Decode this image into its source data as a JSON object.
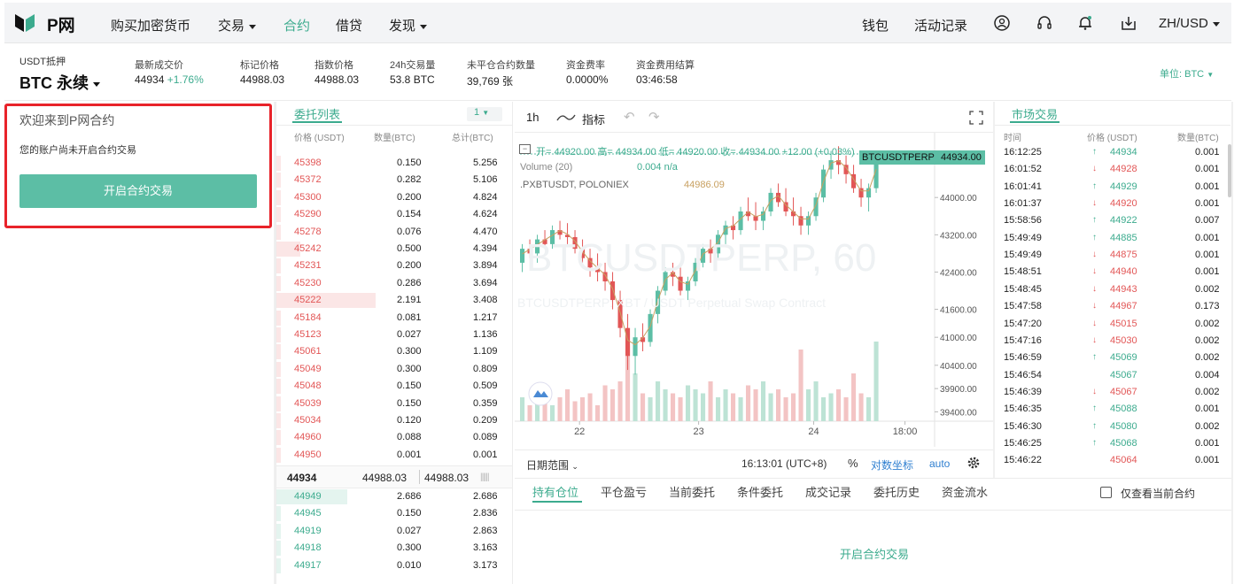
{
  "nav": {
    "logo": "P网",
    "items": [
      "购买加密货币",
      "交易",
      "合约",
      "借贷",
      "发现"
    ],
    "right": [
      "钱包",
      "活动记录"
    ],
    "lang": "ZH/USD"
  },
  "ticker": {
    "collateral": "USDT抵押",
    "pair": "BTC 永续",
    "last_label": "最新成交价",
    "last_value": "44934",
    "last_change": "+1.76%",
    "mark_label": "标记价格",
    "mark_value": "44988.03",
    "index_label": "指数价格",
    "index_value": "44988.03",
    "vol_label": "24h交易量",
    "vol_value": "53.8 BTC",
    "oi_label": "未平仓合约数量",
    "oi_value": "39,769 张",
    "funding_label": "资金费率",
    "funding_value": "0.0000%",
    "settle_label": "资金费用结算",
    "settle_value": "03:46:58",
    "unit": "单位: BTC"
  },
  "welcome": {
    "title": "欢迎来到P网合约",
    "desc": "您的账户尚未开启合约交易",
    "button": "开启合约交易"
  },
  "orderbook": {
    "title": "委托列表",
    "depth": "1",
    "headers": [
      "价格 (USDT)",
      "数量(BTC)",
      "总计(BTC)"
    ],
    "asks": [
      {
        "price": "45398",
        "qty": "0.150",
        "total": "5.256",
        "depth": 0.02
      },
      {
        "price": "45372",
        "qty": "0.282",
        "total": "5.106",
        "depth": 0.02
      },
      {
        "price": "45300",
        "qty": "0.200",
        "total": "4.824",
        "depth": 0.02
      },
      {
        "price": "45290",
        "qty": "0.154",
        "total": "4.624",
        "depth": 0.02
      },
      {
        "price": "45278",
        "qty": "0.076",
        "total": "4.470",
        "depth": 0.02
      },
      {
        "price": "45242",
        "qty": "0.500",
        "total": "4.394",
        "depth": 0.1
      },
      {
        "price": "45231",
        "qty": "0.200",
        "total": "3.894",
        "depth": 0.02
      },
      {
        "price": "45230",
        "qty": "0.286",
        "total": "3.694",
        "depth": 0.02
      },
      {
        "price": "45222",
        "qty": "2.191",
        "total": "3.408",
        "depth": 0.42
      },
      {
        "price": "45184",
        "qty": "0.081",
        "total": "1.217",
        "depth": 0.02
      },
      {
        "price": "45123",
        "qty": "0.027",
        "total": "1.136",
        "depth": 0.02
      },
      {
        "price": "45061",
        "qty": "0.300",
        "total": "1.109",
        "depth": 0.02
      },
      {
        "price": "45049",
        "qty": "0.300",
        "total": "0.809",
        "depth": 0.02
      },
      {
        "price": "45048",
        "qty": "0.150",
        "total": "0.509",
        "depth": 0.02
      },
      {
        "price": "45039",
        "qty": "0.150",
        "total": "0.359",
        "depth": 0.02
      },
      {
        "price": "45034",
        "qty": "0.120",
        "total": "0.209",
        "depth": 0.02
      },
      {
        "price": "44960",
        "qty": "0.088",
        "total": "0.089",
        "depth": 0.02
      },
      {
        "price": "44950",
        "qty": "0.001",
        "total": "0.001",
        "depth": 0.02
      }
    ],
    "mid_last": "44934",
    "mid_mark": "44988.03",
    "mid_index": "44988.03",
    "bids": [
      {
        "price": "44949",
        "qty": "2.686",
        "total": "2.686",
        "depth": 0.3
      },
      {
        "price": "44945",
        "qty": "0.150",
        "total": "2.836",
        "depth": 0.02
      },
      {
        "price": "44919",
        "qty": "0.027",
        "total": "2.863",
        "depth": 0.02
      },
      {
        "price": "44918",
        "qty": "0.300",
        "total": "3.163",
        "depth": 0.02
      },
      {
        "price": "44917",
        "qty": "0.010",
        "total": "3.173",
        "depth": 0.02
      }
    ]
  },
  "chart_toolbar": {
    "interval": "1h",
    "indicators": "指标"
  },
  "chart_legend": {
    "ohlc": "开= 44920.00  高= 44934.00  低= 44920.00  收= 44934.00  +12.00 (+0.03%)",
    "volume_label": "Volume (20)",
    "volume_value": "0.004  n/a",
    "compare_label": ".PXBTUSDT, POLONIEX",
    "compare_value": "44986.09",
    "watermark": "BTCUSDTPERP, 60",
    "watermark_sub": "BTCUSDTPERP: XBT / USDT Perpetual Swap Contract",
    "price_tag_symbol": "BTCUSDTPERP",
    "price_tag_value": "44934.00"
  },
  "chart_data": {
    "type": "candlestick",
    "yticks": [
      "44000.00",
      "43200.00",
      "42400.00",
      "41600.00",
      "41000.00",
      "40400.00",
      "39900.00",
      "39400.00"
    ],
    "xticks": [
      "22",
      "23",
      "24",
      "18:00"
    ],
    "yrange": [
      39200,
      45200
    ],
    "last_price": 44934,
    "candles": [
      [
        42600,
        43000,
        42400,
        42900
      ],
      [
        42900,
        43100,
        42700,
        42800
      ],
      [
        42800,
        43200,
        42600,
        43100
      ],
      [
        43100,
        43300,
        42900,
        43000
      ],
      [
        43000,
        43400,
        42900,
        43300
      ],
      [
        43300,
        43500,
        43100,
        43200
      ],
      [
        43200,
        43450,
        43000,
        43150
      ],
      [
        43150,
        43300,
        42800,
        42900
      ],
      [
        42900,
        43100,
        42600,
        42700
      ],
      [
        42700,
        42900,
        42300,
        42500
      ],
      [
        42500,
        42800,
        42200,
        42400
      ],
      [
        42400,
        42600,
        42000,
        42200
      ],
      [
        42200,
        42400,
        41600,
        41800
      ],
      [
        41800,
        42000,
        41000,
        41200
      ],
      [
        41200,
        41500,
        40300,
        40600
      ],
      [
        40600,
        41200,
        40200,
        41000
      ],
      [
        41000,
        41300,
        40700,
        40900
      ],
      [
        40900,
        41600,
        40800,
        41500
      ],
      [
        41500,
        42100,
        41300,
        42000
      ],
      [
        42000,
        42500,
        41900,
        42400
      ],
      [
        42400,
        42600,
        42100,
        42300
      ],
      [
        42300,
        42500,
        41900,
        42000
      ],
      [
        42000,
        42300,
        41800,
        42200
      ],
      [
        42200,
        42700,
        42100,
        42600
      ],
      [
        42600,
        43000,
        42500,
        42900
      ],
      [
        42900,
        43100,
        42600,
        42800
      ],
      [
        42800,
        43300,
        42700,
        43200
      ],
      [
        43200,
        43500,
        43000,
        43400
      ],
      [
        43400,
        43600,
        43100,
        43300
      ],
      [
        43300,
        43800,
        43200,
        43700
      ],
      [
        43700,
        44000,
        43500,
        43600
      ],
      [
        43600,
        43900,
        43300,
        43500
      ],
      [
        43500,
        43800,
        43300,
        43700
      ],
      [
        43700,
        44200,
        43600,
        44100
      ],
      [
        44100,
        44300,
        43800,
        43900
      ],
      [
        43900,
        44200,
        43600,
        43700
      ],
      [
        43700,
        44000,
        43400,
        43600
      ],
      [
        43600,
        43800,
        43200,
        43400
      ],
      [
        43400,
        43700,
        43200,
        43600
      ],
      [
        43600,
        44100,
        43500,
        44000
      ],
      [
        44000,
        44700,
        43900,
        44600
      ],
      [
        44600,
        45000,
        44400,
        44800
      ],
      [
        44800,
        45100,
        44500,
        44700
      ],
      [
        44700,
        44900,
        44300,
        44500
      ],
      [
        44500,
        44700,
        44100,
        44200
      ],
      [
        44200,
        44400,
        43800,
        44000
      ],
      [
        44000,
        44300,
        43700,
        44200
      ],
      [
        44200,
        44934,
        44100,
        44934
      ]
    ],
    "volumes": [
      0.3,
      0.2,
      0.25,
      0.35,
      0.2,
      0.3,
      0.4,
      0.25,
      0.3,
      0.35,
      0.2,
      0.45,
      0.4,
      0.5,
      0.95,
      0.6,
      0.35,
      0.3,
      0.5,
      0.4,
      0.35,
      0.3,
      0.45,
      0.4,
      0.35,
      0.5,
      0.3,
      0.4,
      0.35,
      0.3,
      0.45,
      0.4,
      0.5,
      0.35,
      0.4,
      0.3,
      0.35,
      0.9,
      0.4,
      0.5,
      0.3,
      0.35,
      0.4,
      0.3,
      0.6,
      0.35,
      0.3,
      1.0
    ]
  },
  "chart_footer": {
    "range": "日期范围",
    "time": "16:13:01 (UTC+8)",
    "percent": "%",
    "log": "对数坐标",
    "auto": "auto"
  },
  "trades": {
    "title": "市场交易",
    "headers": [
      "时间",
      "价格 (USDT)",
      "数量(BTC)"
    ],
    "rows": [
      {
        "time": "16:12:25",
        "dir": "up",
        "price": "44934",
        "qty": "0.001"
      },
      {
        "time": "16:01:52",
        "dir": "down",
        "price": "44928",
        "qty": "0.001"
      },
      {
        "time": "16:01:41",
        "dir": "up",
        "price": "44929",
        "qty": "0.001"
      },
      {
        "time": "16:01:37",
        "dir": "down",
        "price": "44920",
        "qty": "0.001"
      },
      {
        "time": "15:58:56",
        "dir": "up",
        "price": "44922",
        "qty": "0.007"
      },
      {
        "time": "15:49:49",
        "dir": "up",
        "price": "44885",
        "qty": "0.001"
      },
      {
        "time": "15:49:49",
        "dir": "down",
        "price": "44875",
        "qty": "0.001"
      },
      {
        "time": "15:48:51",
        "dir": "down",
        "price": "44940",
        "qty": "0.001"
      },
      {
        "time": "15:48:45",
        "dir": "down",
        "price": "44943",
        "qty": "0.002"
      },
      {
        "time": "15:47:58",
        "dir": "down",
        "price": "44967",
        "qty": "0.173"
      },
      {
        "time": "15:47:20",
        "dir": "down",
        "price": "45015",
        "qty": "0.002"
      },
      {
        "time": "15:47:16",
        "dir": "down",
        "price": "45030",
        "qty": "0.002"
      },
      {
        "time": "15:46:59",
        "dir": "up",
        "price": "45069",
        "qty": "0.002"
      },
      {
        "time": "15:46:54",
        "dir": "none-up",
        "price": "45067",
        "qty": "0.004"
      },
      {
        "time": "15:46:39",
        "dir": "down",
        "price": "45067",
        "qty": "0.002"
      },
      {
        "time": "15:46:35",
        "dir": "up",
        "price": "45088",
        "qty": "0.001"
      },
      {
        "time": "15:46:30",
        "dir": "up",
        "price": "45080",
        "qty": "0.002"
      },
      {
        "time": "15:46:25",
        "dir": "up",
        "price": "45068",
        "qty": "0.001"
      },
      {
        "time": "15:46:22",
        "dir": "none-down",
        "price": "45064",
        "qty": "0.001"
      }
    ]
  },
  "bottom": {
    "tabs": [
      "持有仓位",
      "平仓盈亏",
      "当前委托",
      "条件委托",
      "成交记录",
      "委托历史",
      "资金流水"
    ],
    "only_current": "仅查看当前合约",
    "open_link": "开启合约交易"
  },
  "colors": {
    "accent": "#3cab8e",
    "up": "#5cbea5",
    "down": "#e25656",
    "warning_border": "#e8232a"
  }
}
